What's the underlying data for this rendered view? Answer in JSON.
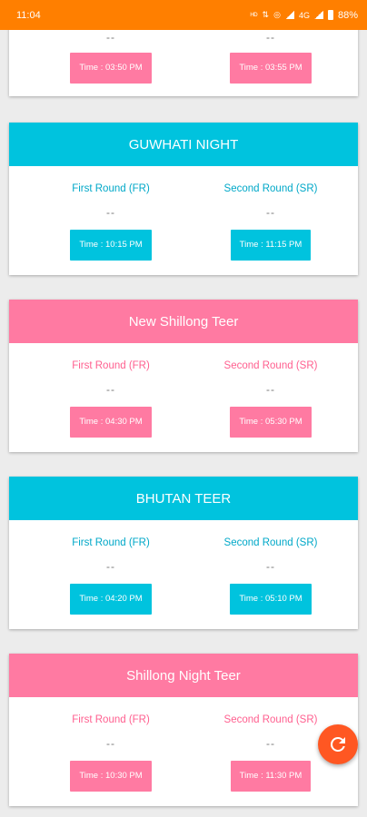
{
  "status_bar": {
    "time": "11:04",
    "battery": "88%",
    "icons": [
      "volte-icon",
      "data-icon",
      "hotspot-icon",
      "signal-icon",
      "network-4g-icon",
      "signal-icon",
      "battery-icon"
    ]
  },
  "partial_card": {
    "fr_result": "--",
    "sr_result": "--",
    "fr_time": "Time : 03:50 PM",
    "sr_time": "Time : 03:55 PM"
  },
  "cards": [
    {
      "title": "GUWHATI NIGHT",
      "color": "#00c3de",
      "fr_label": "First Round (FR)",
      "sr_label": "Second Round (SR)",
      "fr_result": "--",
      "sr_result": "--",
      "fr_time": "Time : 10:15 PM",
      "sr_time": "Time : 11:15 PM"
    },
    {
      "title": "New Shillong Teer",
      "color": "#ff7aa2",
      "fr_label": "First Round (FR)",
      "sr_label": "Second Round (SR)",
      "fr_result": "--",
      "sr_result": "--",
      "fr_time": "Time : 04:30 PM",
      "sr_time": "Time : 05:30 PM"
    },
    {
      "title": "BHUTAN TEER",
      "color": "#00c3de",
      "fr_label": "First Round (FR)",
      "sr_label": "Second Round (SR)",
      "fr_result": "--",
      "sr_result": "--",
      "fr_time": "Time : 04:20 PM",
      "sr_time": "Time : 05:10 PM"
    },
    {
      "title": "Shillong Night Teer",
      "color": "#ff7aa2",
      "fr_label": "First Round (FR)",
      "sr_label": "Second Round (SR)",
      "fr_result": "--",
      "sr_result": "--",
      "fr_time": "Time : 10:30 PM",
      "sr_time": "Time : 11:30 PM"
    }
  ],
  "fab": {
    "icon": "refresh-icon",
    "color": "#ff5722"
  }
}
